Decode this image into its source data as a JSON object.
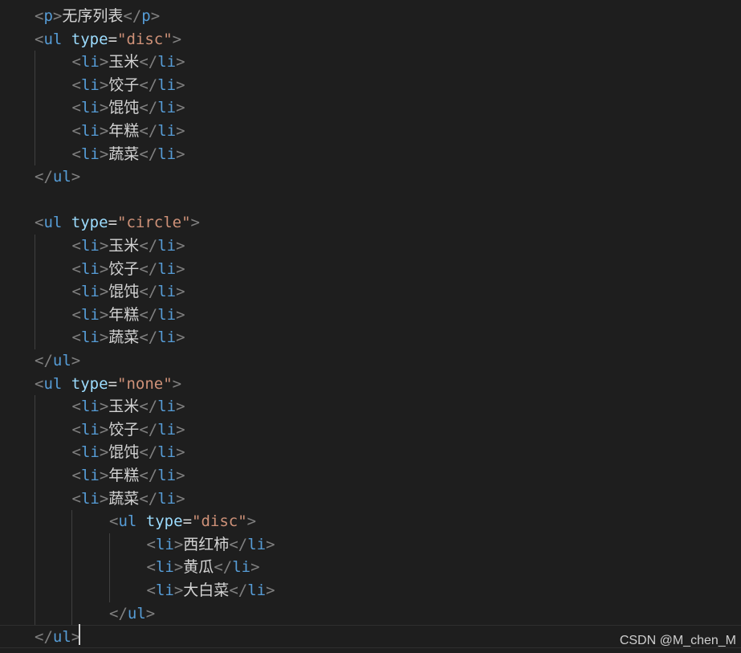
{
  "editor": {
    "lines": [
      {
        "indent": 1,
        "tokens": [
          [
            "bracket",
            "<"
          ],
          [
            "tag",
            "p"
          ],
          [
            "bracket",
            ">"
          ],
          [
            "text",
            "无序列表"
          ],
          [
            "bracket",
            "</"
          ],
          [
            "tag",
            "p"
          ],
          [
            "bracket",
            ">"
          ]
        ]
      },
      {
        "indent": 1,
        "tokens": [
          [
            "bracket",
            "<"
          ],
          [
            "tag",
            "ul"
          ],
          [
            "text",
            " "
          ],
          [
            "attr",
            "type"
          ],
          [
            "eq",
            "="
          ],
          [
            "string",
            "\"disc\""
          ],
          [
            "bracket",
            ">"
          ]
        ]
      },
      {
        "indent": 2,
        "tokens": [
          [
            "bracket",
            "<"
          ],
          [
            "tag",
            "li"
          ],
          [
            "bracket",
            ">"
          ],
          [
            "text",
            "玉米"
          ],
          [
            "bracket",
            "</"
          ],
          [
            "tag",
            "li"
          ],
          [
            "bracket",
            ">"
          ]
        ]
      },
      {
        "indent": 2,
        "tokens": [
          [
            "bracket",
            "<"
          ],
          [
            "tag",
            "li"
          ],
          [
            "bracket",
            ">"
          ],
          [
            "text",
            "饺子"
          ],
          [
            "bracket",
            "</"
          ],
          [
            "tag",
            "li"
          ],
          [
            "bracket",
            ">"
          ]
        ]
      },
      {
        "indent": 2,
        "tokens": [
          [
            "bracket",
            "<"
          ],
          [
            "tag",
            "li"
          ],
          [
            "bracket",
            ">"
          ],
          [
            "text",
            "馄饨"
          ],
          [
            "bracket",
            "</"
          ],
          [
            "tag",
            "li"
          ],
          [
            "bracket",
            ">"
          ]
        ]
      },
      {
        "indent": 2,
        "tokens": [
          [
            "bracket",
            "<"
          ],
          [
            "tag",
            "li"
          ],
          [
            "bracket",
            ">"
          ],
          [
            "text",
            "年糕"
          ],
          [
            "bracket",
            "</"
          ],
          [
            "tag",
            "li"
          ],
          [
            "bracket",
            ">"
          ]
        ]
      },
      {
        "indent": 2,
        "tokens": [
          [
            "bracket",
            "<"
          ],
          [
            "tag",
            "li"
          ],
          [
            "bracket",
            ">"
          ],
          [
            "text",
            "蔬菜"
          ],
          [
            "bracket",
            "</"
          ],
          [
            "tag",
            "li"
          ],
          [
            "bracket",
            ">"
          ]
        ]
      },
      {
        "indent": 1,
        "tokens": [
          [
            "bracket",
            "</"
          ],
          [
            "tag",
            "ul"
          ],
          [
            "bracket",
            ">"
          ]
        ]
      },
      {
        "indent": 0,
        "tokens": []
      },
      {
        "indent": 1,
        "tokens": [
          [
            "bracket",
            "<"
          ],
          [
            "tag",
            "ul"
          ],
          [
            "text",
            " "
          ],
          [
            "attr",
            "type"
          ],
          [
            "eq",
            "="
          ],
          [
            "string",
            "\"circle\""
          ],
          [
            "bracket",
            ">"
          ]
        ]
      },
      {
        "indent": 2,
        "tokens": [
          [
            "bracket",
            "<"
          ],
          [
            "tag",
            "li"
          ],
          [
            "bracket",
            ">"
          ],
          [
            "text",
            "玉米"
          ],
          [
            "bracket",
            "</"
          ],
          [
            "tag",
            "li"
          ],
          [
            "bracket",
            ">"
          ]
        ]
      },
      {
        "indent": 2,
        "tokens": [
          [
            "bracket",
            "<"
          ],
          [
            "tag",
            "li"
          ],
          [
            "bracket",
            ">"
          ],
          [
            "text",
            "饺子"
          ],
          [
            "bracket",
            "</"
          ],
          [
            "tag",
            "li"
          ],
          [
            "bracket",
            ">"
          ]
        ]
      },
      {
        "indent": 2,
        "tokens": [
          [
            "bracket",
            "<"
          ],
          [
            "tag",
            "li"
          ],
          [
            "bracket",
            ">"
          ],
          [
            "text",
            "馄饨"
          ],
          [
            "bracket",
            "</"
          ],
          [
            "tag",
            "li"
          ],
          [
            "bracket",
            ">"
          ]
        ]
      },
      {
        "indent": 2,
        "tokens": [
          [
            "bracket",
            "<"
          ],
          [
            "tag",
            "li"
          ],
          [
            "bracket",
            ">"
          ],
          [
            "text",
            "年糕"
          ],
          [
            "bracket",
            "</"
          ],
          [
            "tag",
            "li"
          ],
          [
            "bracket",
            ">"
          ]
        ]
      },
      {
        "indent": 2,
        "tokens": [
          [
            "bracket",
            "<"
          ],
          [
            "tag",
            "li"
          ],
          [
            "bracket",
            ">"
          ],
          [
            "text",
            "蔬菜"
          ],
          [
            "bracket",
            "</"
          ],
          [
            "tag",
            "li"
          ],
          [
            "bracket",
            ">"
          ]
        ]
      },
      {
        "indent": 1,
        "tokens": [
          [
            "bracket",
            "</"
          ],
          [
            "tag",
            "ul"
          ],
          [
            "bracket",
            ">"
          ]
        ]
      },
      {
        "indent": 1,
        "tokens": [
          [
            "bracket",
            "<"
          ],
          [
            "tag",
            "ul"
          ],
          [
            "text",
            " "
          ],
          [
            "attr",
            "type"
          ],
          [
            "eq",
            "="
          ],
          [
            "string",
            "\"none\""
          ],
          [
            "bracket",
            ">"
          ]
        ]
      },
      {
        "indent": 2,
        "tokens": [
          [
            "bracket",
            "<"
          ],
          [
            "tag",
            "li"
          ],
          [
            "bracket",
            ">"
          ],
          [
            "text",
            "玉米"
          ],
          [
            "bracket",
            "</"
          ],
          [
            "tag",
            "li"
          ],
          [
            "bracket",
            ">"
          ]
        ]
      },
      {
        "indent": 2,
        "tokens": [
          [
            "bracket",
            "<"
          ],
          [
            "tag",
            "li"
          ],
          [
            "bracket",
            ">"
          ],
          [
            "text",
            "饺子"
          ],
          [
            "bracket",
            "</"
          ],
          [
            "tag",
            "li"
          ],
          [
            "bracket",
            ">"
          ]
        ]
      },
      {
        "indent": 2,
        "tokens": [
          [
            "bracket",
            "<"
          ],
          [
            "tag",
            "li"
          ],
          [
            "bracket",
            ">"
          ],
          [
            "text",
            "馄饨"
          ],
          [
            "bracket",
            "</"
          ],
          [
            "tag",
            "li"
          ],
          [
            "bracket",
            ">"
          ]
        ]
      },
      {
        "indent": 2,
        "tokens": [
          [
            "bracket",
            "<"
          ],
          [
            "tag",
            "li"
          ],
          [
            "bracket",
            ">"
          ],
          [
            "text",
            "年糕"
          ],
          [
            "bracket",
            "</"
          ],
          [
            "tag",
            "li"
          ],
          [
            "bracket",
            ">"
          ]
        ]
      },
      {
        "indent": 2,
        "tokens": [
          [
            "bracket",
            "<"
          ],
          [
            "tag",
            "li"
          ],
          [
            "bracket",
            ">"
          ],
          [
            "text",
            "蔬菜"
          ],
          [
            "bracket",
            "</"
          ],
          [
            "tag",
            "li"
          ],
          [
            "bracket",
            ">"
          ]
        ]
      },
      {
        "indent": 3,
        "tokens": [
          [
            "bracket",
            "<"
          ],
          [
            "tag",
            "ul"
          ],
          [
            "text",
            " "
          ],
          [
            "attr",
            "type"
          ],
          [
            "eq",
            "="
          ],
          [
            "string",
            "\"disc\""
          ],
          [
            "bracket",
            ">"
          ]
        ]
      },
      {
        "indent": 4,
        "tokens": [
          [
            "bracket",
            "<"
          ],
          [
            "tag",
            "li"
          ],
          [
            "bracket",
            ">"
          ],
          [
            "text",
            "西红柿"
          ],
          [
            "bracket",
            "</"
          ],
          [
            "tag",
            "li"
          ],
          [
            "bracket",
            ">"
          ]
        ]
      },
      {
        "indent": 4,
        "tokens": [
          [
            "bracket",
            "<"
          ],
          [
            "tag",
            "li"
          ],
          [
            "bracket",
            ">"
          ],
          [
            "text",
            "黄瓜"
          ],
          [
            "bracket",
            "</"
          ],
          [
            "tag",
            "li"
          ],
          [
            "bracket",
            ">"
          ]
        ]
      },
      {
        "indent": 4,
        "tokens": [
          [
            "bracket",
            "<"
          ],
          [
            "tag",
            "li"
          ],
          [
            "bracket",
            ">"
          ],
          [
            "text",
            "大白菜"
          ],
          [
            "bracket",
            "</"
          ],
          [
            "tag",
            "li"
          ],
          [
            "bracket",
            ">"
          ]
        ]
      },
      {
        "indent": 3,
        "tokens": [
          [
            "bracket",
            "</"
          ],
          [
            "tag",
            "ul"
          ],
          [
            "bracket",
            ">"
          ]
        ]
      },
      {
        "indent": 1,
        "tokens": [
          [
            "bracket",
            "</"
          ],
          [
            "tag",
            "ul"
          ],
          [
            "bracket",
            ">"
          ]
        ],
        "current": true
      }
    ]
  },
  "watermark": "CSDN @M_chen_M",
  "colors": {
    "background": "#1e1e1e",
    "bracket": "#808080",
    "tag": "#569cd6",
    "attribute": "#9cdcfe",
    "string": "#ce9178",
    "text": "#d4d4d4",
    "indent_guide": "#404040"
  }
}
